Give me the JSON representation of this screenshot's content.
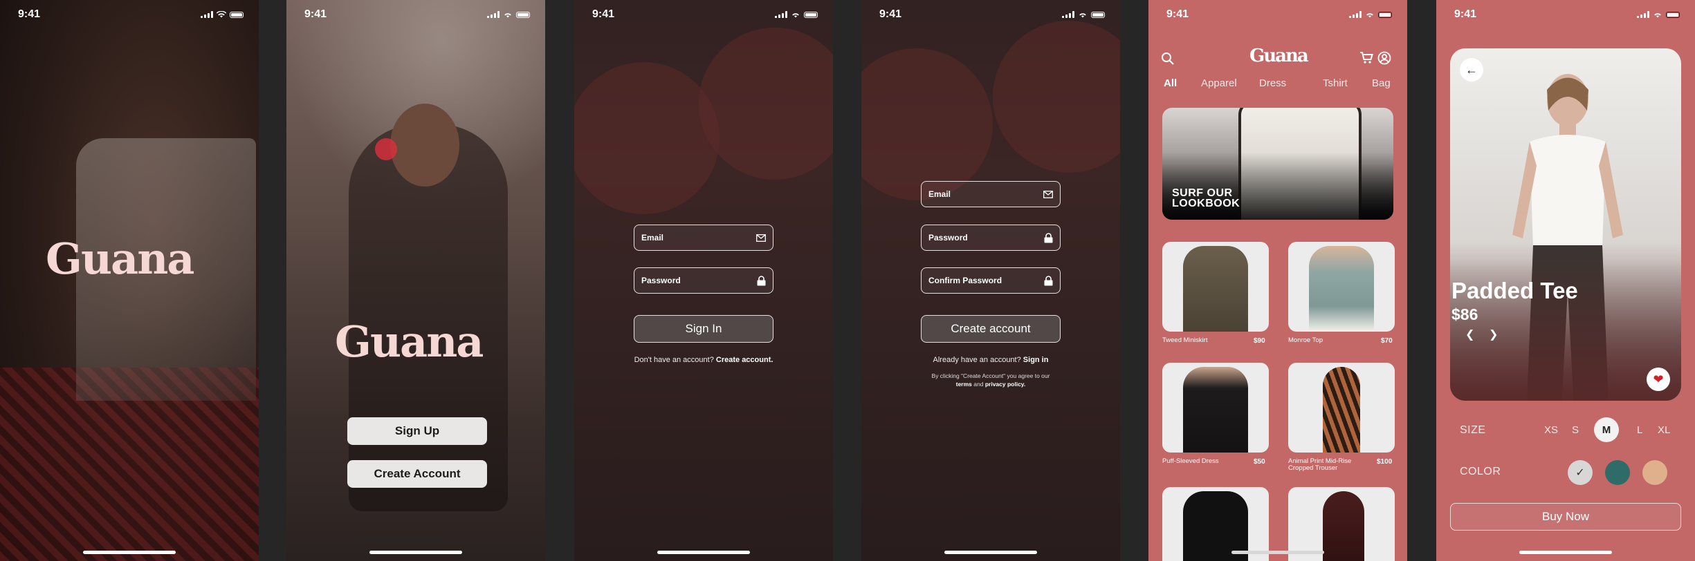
{
  "status": {
    "time": "9:41"
  },
  "brand": {
    "logo": "Guana"
  },
  "welcome": {
    "signup_label": "Sign Up",
    "create_label": "Create Account"
  },
  "signin": {
    "email_placeholder": "Email",
    "password_placeholder": "Password",
    "submit_label": "Sign In",
    "prompt": "Don't have an account?",
    "prompt_link": "Create account."
  },
  "signup": {
    "email_placeholder": "Email",
    "password_placeholder": "Password",
    "confirm_placeholder": "Confirm Password",
    "submit_label": "Create account",
    "prompt": "Already have an account?",
    "prompt_link": "Sign in",
    "legal_prefix": "By clicking \"Create Account\" you agree to our",
    "legal_terms": "terms",
    "legal_and": "and",
    "legal_privacy": "privacy policy."
  },
  "shop": {
    "tabs": [
      "All",
      "Apparel",
      "Dress",
      "Tshirt",
      "Bag"
    ],
    "banner_line1": "SURF OUR",
    "banner_line2": "LOOKBOOK",
    "products": [
      {
        "name": "Tweed Miniskirt",
        "price": "$90"
      },
      {
        "name": "Monroe Top",
        "price": "$70"
      },
      {
        "name": "Puff-Sleeved Dress",
        "price": "$50"
      },
      {
        "name": "Animal Print Mid-Rise Cropped Trouser",
        "price": "$100"
      }
    ]
  },
  "product": {
    "title": "Padded Tee",
    "price": "$86",
    "size_label": "SIZE",
    "sizes": [
      "XS",
      "S",
      "M",
      "L",
      "XL"
    ],
    "selected_size": "M",
    "color_label": "COLOR",
    "colors": [
      "#d9d6d6",
      "#2e6b69",
      "#e0b08d"
    ],
    "buy_label": "Buy Now"
  },
  "colors": {
    "brand_bg": "#c36767",
    "logo": "#f5d7d3"
  }
}
